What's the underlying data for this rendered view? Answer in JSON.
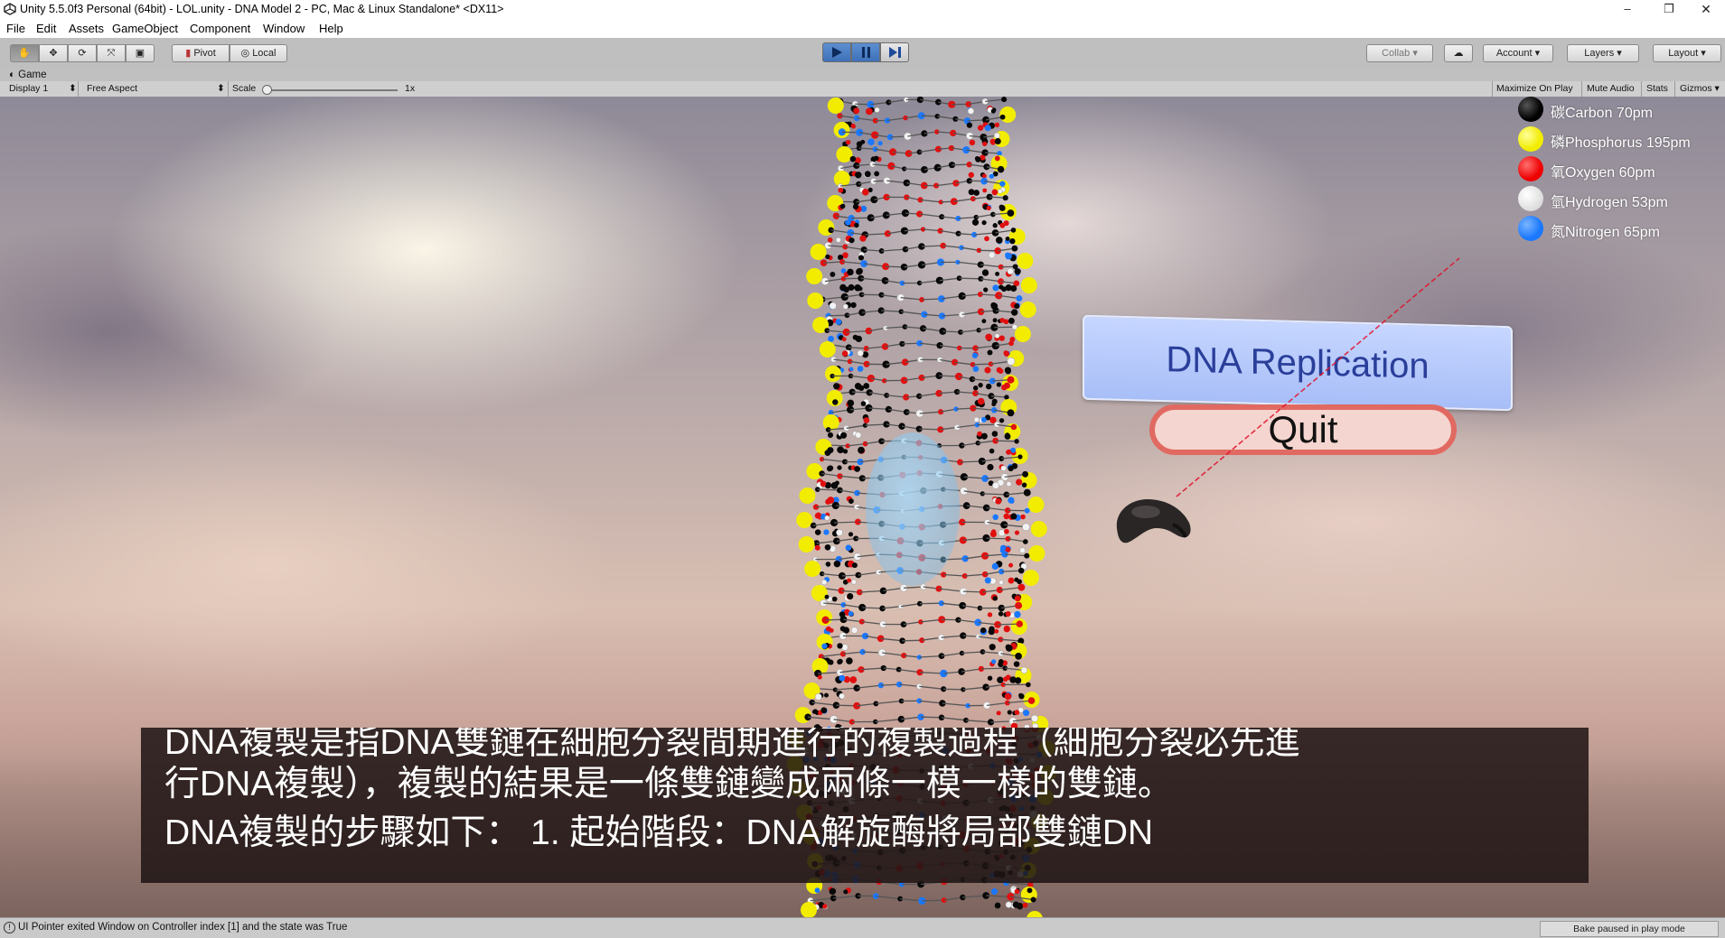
{
  "window": {
    "title": "Unity 5.5.0f3 Personal (64bit) - LOL.unity - DNA Model 2 - PC, Mac & Linux Standalone* <DX11>",
    "minimize": "–",
    "maximize": "❐",
    "close": "✕"
  },
  "menu": [
    "File",
    "Edit",
    "Assets",
    "GameObject",
    "Component",
    "Window",
    "Help"
  ],
  "toolbar": {
    "pivot_label": "Pivot",
    "local_label": "Local",
    "collab_label": "Collab ▾",
    "account_label": "Account ▾",
    "layers_label": "Layers ▾",
    "layout_label": "Layout ▾"
  },
  "game_view": {
    "tab_label": "Game",
    "display": "Display 1",
    "aspect": "Free Aspect",
    "scale_label": "Scale",
    "scale_value": "1x",
    "scale_level": 0.0,
    "maximize_on_play": "Maximize On Play",
    "mute_audio": "Mute Audio",
    "stats": "Stats",
    "gizmos": "Gizmos ▾"
  },
  "legend": [
    {
      "label": "碳Carbon 70pm",
      "color": "#050505"
    },
    {
      "label": "磷Phosphorus 195pm",
      "color": "#f2ec00"
    },
    {
      "label": "氧Oxygen 60pm",
      "color": "#ee0000"
    },
    {
      "label": "氫Hydrogen 53pm",
      "color": "#f4f4f4"
    },
    {
      "label": "氮Nitrogen 65pm",
      "color": "#1a78ff"
    }
  ],
  "menu_panel": {
    "dna_button": "DNA Replication",
    "quit_button": "Quit"
  },
  "subtitle": {
    "line1": "DNA複製是指DNA雙鏈在細胞分裂間期進行的複製過程（細胞分裂必先進",
    "line2": "行DNA複製），複製的結果是一條雙鏈變成兩條一模一樣的雙鏈。",
    "line3": "DNA複製的步驟如下： 1. 起始階段：DNA解旋酶將局部雙鏈DN"
  },
  "status": {
    "message": "UI Pointer exited Window on Controller index [1] and the state was True",
    "bake": "Bake paused in play mode"
  },
  "colors": {
    "play_active": "#3e71b9",
    "dna_button_text": "#2a3e9a",
    "quit_border": "#e06a62"
  }
}
